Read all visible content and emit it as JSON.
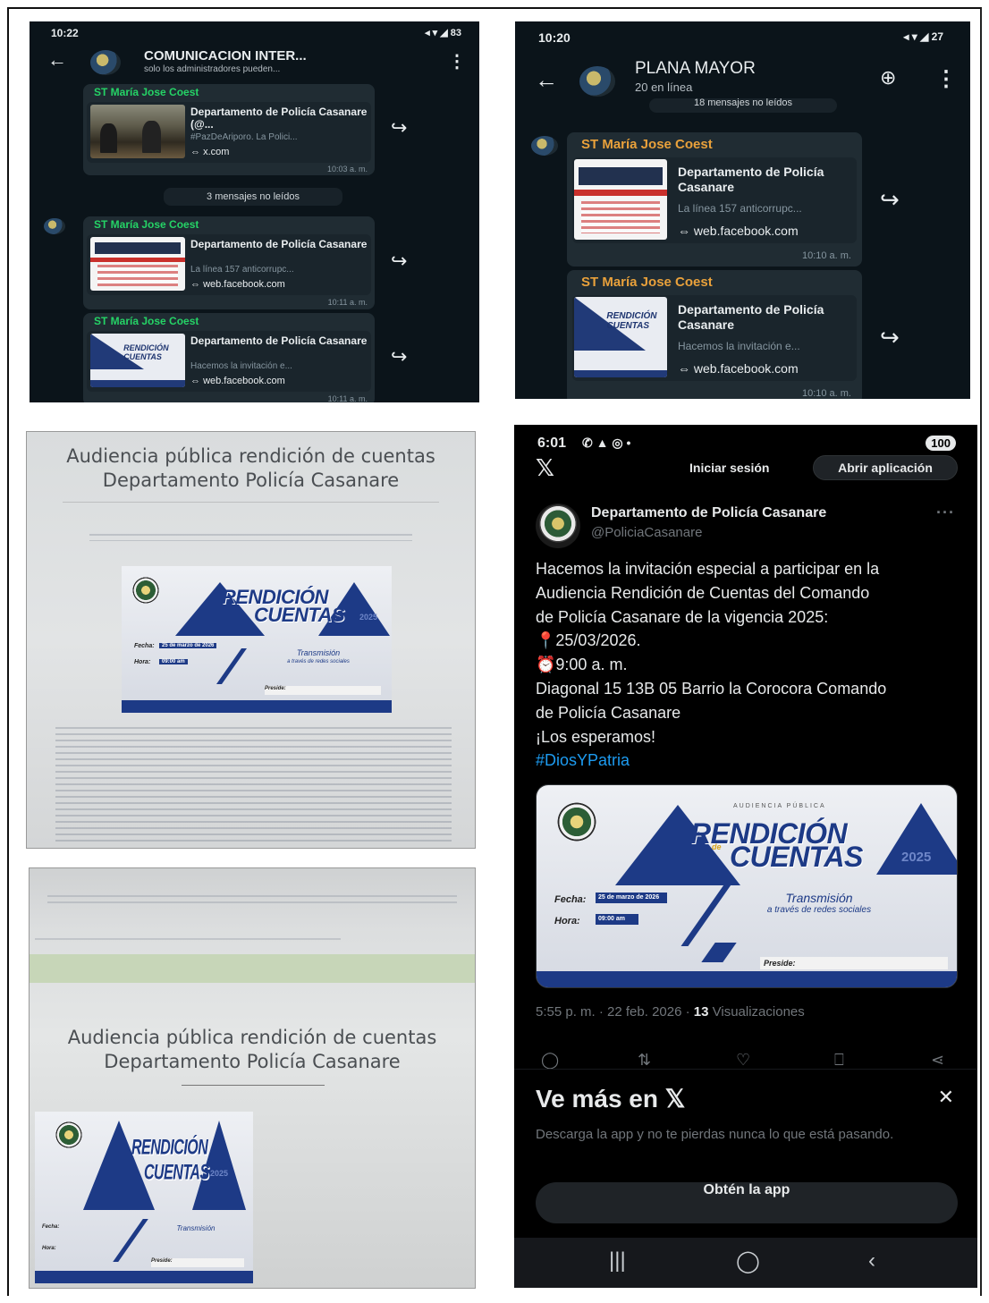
{
  "wa1": {
    "status_time": "10:22",
    "status_right": "◂ ▾ ◢ 83",
    "title": "COMUNICACION INTER...",
    "subtitle": "solo los administradores pueden...",
    "unread": "3 mensajes no leídos",
    "messages": [
      {
        "sender": "ST María Jose Coest",
        "title": "Departamento de Policía Casanare (@...",
        "desc": "#PazDeAriporo. La Polici...",
        "domain": "x.com",
        "time": "10:03 a. m."
      },
      {
        "sender": "ST María Jose Coest",
        "title": "Departamento de Policía Casanare",
        "desc": "La línea 157 anticorrupc...",
        "domain": "web.facebook.com",
        "time": "10:11 a. m."
      },
      {
        "sender": "ST María Jose Coest",
        "title": "Departamento de Policía Casanare",
        "desc": "Hacemos la invitación e...",
        "domain": "web.facebook.com",
        "time": "10:11 a. m."
      }
    ]
  },
  "wa2": {
    "status_time": "10:20",
    "status_right": "◂ ▾ ◢ 27",
    "title": "PLANA MAYOR",
    "subtitle": "20 en línea",
    "unread": "18 mensajes no leídos",
    "messages": [
      {
        "sender": "ST María Jose Coest",
        "title": "Departamento de Policía Casanare",
        "desc": "La línea 157 anticorrupc...",
        "domain": "web.facebook.com",
        "time": "10:10 a. m."
      },
      {
        "sender": "ST María Jose Coest",
        "title": "Departamento de Policía Casanare",
        "desc": "Hacemos la invitación e...",
        "domain": "web.facebook.com",
        "time": "10:10 a. m."
      }
    ]
  },
  "doc1": {
    "title_line1": "Audiencia pública rendición de cuentas",
    "title_line2": "Departamento Policía Casanare"
  },
  "doc2": {
    "title_line1": "Audiencia pública rendición de cuentas",
    "title_line2": "Departamento Policía Casanare"
  },
  "banner": {
    "kicker": "AUDIENCIA PÚBLICA",
    "word1": "RENDICIÓN",
    "word_de": "de",
    "word2": "CUENTAS",
    "year": "2025",
    "fecha_label": "Fecha:",
    "fecha_value": "25 de marzo de 2026",
    "hora_label": "Hora:",
    "hora_value": "09:00 am",
    "trans1": "Transmisión",
    "trans2": "a través de redes sociales",
    "preside_label": "Preside:"
  },
  "x": {
    "status_time": "6:01",
    "status_battery": "100",
    "logo": "𝕏",
    "signin": "Iniciar sesión",
    "open_app": "Abrir aplicación",
    "name": "Departamento de Policía Casanare",
    "handle": "@PoliciaCasanare",
    "more": "···",
    "body_lines": [
      "Hacemos la invitación especial a participar en la",
      "Audiencia Rendición de Cuentas del Comando",
      "de Policía Casanare de la vigencia 2025:",
      "📍25/03/2026.",
      "⏰9:00 a. m.",
      "Diagonal 15 13B 05 Barrio la Corocora Comando",
      "de Policía Casanare",
      "¡Los esperamos!"
    ],
    "hashtag": "#DiosYPatria",
    "meta_prefix": "5:55 p. m. · 22 feb. 2026 · ",
    "views_count": "13",
    "views_label": " Visualizaciones",
    "sheet_title": "Ve más en 𝕏",
    "sheet_desc": "Descarga la app y no te pierdas nunca lo que está pasando.",
    "get_app": "Obtén la app"
  }
}
